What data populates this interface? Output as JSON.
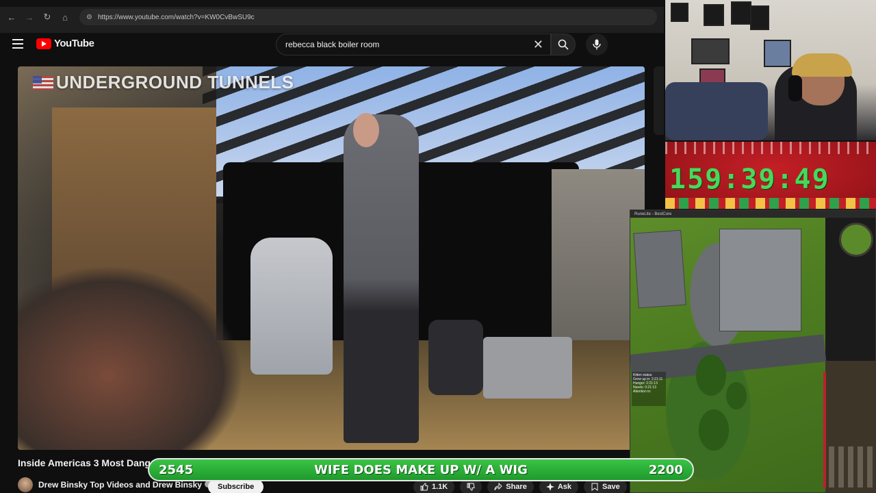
{
  "browser": {
    "url": "https://www.youtube.com/watch?v=KW0CvBwSU9c",
    "nav_icons": [
      "back-icon",
      "forward-icon",
      "reload-icon",
      "home-icon",
      "site-settings-icon"
    ]
  },
  "youtube": {
    "logo_text": "YouTube",
    "search_value": "rebecca black boiler room",
    "icons": [
      "menu-icon",
      "clear-icon",
      "search-icon",
      "mic-icon"
    ]
  },
  "video": {
    "overlay_title": "UNDERGROUND TUNNELS",
    "title": "Inside Americas 3 Most Dang",
    "channel": "Drew Binsky Top Videos and Drew Binsky",
    "subscribe_label": "Subscribe",
    "like_count": "1.1K",
    "share_label": "Share",
    "ask_label": "Ask",
    "save_label": "Save"
  },
  "stream": {
    "timer": "159:39:49",
    "banner_left": "2545",
    "banner_center": "WIFE DOES MAKE UP W/ A WIG",
    "banner_right": "2200",
    "game_title": "RuneLite - BestCore",
    "game_status_title": "Kitten status",
    "game_status_lines": [
      "Grow up in: 2:21:11",
      "Hunger: 2:21:13",
      "Needs: 0:21:13",
      "Attention in:"
    ]
  },
  "colors": {
    "youtube_red": "#ff0000",
    "banner_green": "#2bb03a",
    "timer_green": "#48d85a",
    "timer_red": "#c41f26"
  }
}
